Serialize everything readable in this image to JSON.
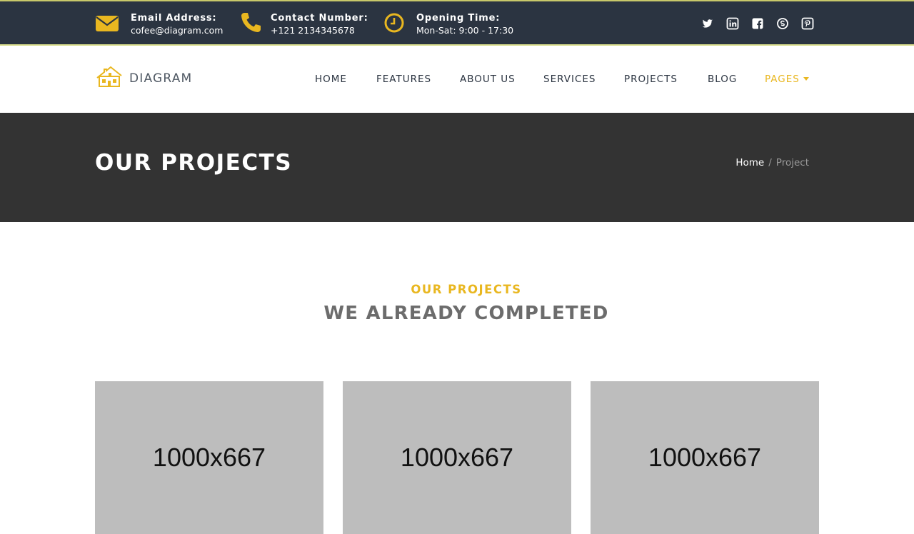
{
  "topbar": {
    "email": {
      "label": "Email Address:",
      "value": "cofee@diagram.com",
      "icon": "envelope-icon"
    },
    "phone": {
      "label": "Contact Number:",
      "value": "+121 2134345678",
      "icon": "phone-icon"
    },
    "hours": {
      "label": "Opening Time:",
      "value": "Mon-Sat: 9:00 - 17:30",
      "icon": "clock-icon"
    },
    "social": [
      "twitter-icon",
      "linkedin-icon",
      "facebook-icon",
      "skype-icon",
      "pinterest-icon"
    ]
  },
  "header": {
    "logo_text": "DIAGRAM",
    "nav": [
      "HOME",
      "FEATURES",
      "ABOUT US",
      "SERVICES",
      "PROJECTS",
      "BLOG",
      "PAGES"
    ]
  },
  "banner": {
    "title": "OUR PROJECTS",
    "breadcrumb": {
      "home": "Home",
      "separator": "/",
      "current": "Project"
    }
  },
  "section": {
    "subtitle": "OUR PROJECTS",
    "title": "WE ALREADY COMPLETED"
  },
  "projects": [
    {
      "placeholder": "1000x667"
    },
    {
      "placeholder": "1000x667"
    },
    {
      "placeholder": "1000x667"
    }
  ],
  "colors": {
    "accent": "#e9b720",
    "topbar_bg": "#2b3441",
    "band_bg": "#333333",
    "placeholder_bg": "#bdbdbd"
  }
}
